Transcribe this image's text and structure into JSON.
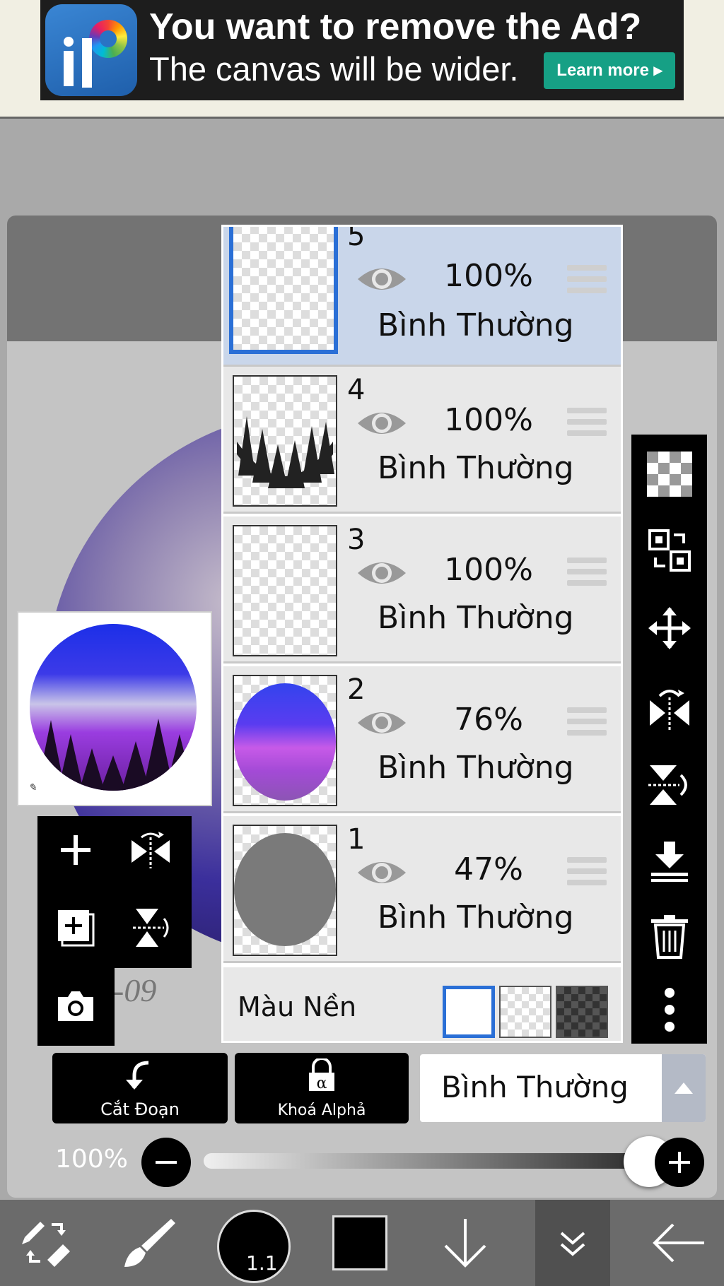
{
  "ad": {
    "title": "You want to remove the Ad?",
    "subtitle": "The canvas will be wider.",
    "learn_more": "Learn more ▸"
  },
  "canvas": {
    "sketch_text": "-09"
  },
  "layers": [
    {
      "num": "5",
      "opacity": "100%",
      "blend": "Bình Thường",
      "selected": true
    },
    {
      "num": "4",
      "opacity": "100%",
      "blend": "Bình Thường",
      "selected": false
    },
    {
      "num": "3",
      "opacity": "100%",
      "blend": "Bình Thường",
      "selected": false
    },
    {
      "num": "2",
      "opacity": "76%",
      "blend": "Bình Thường",
      "selected": false
    },
    {
      "num": "1",
      "opacity": "47%",
      "blend": "Bình Thường",
      "selected": false
    }
  ],
  "background": {
    "label": "Màu Nền"
  },
  "controls": {
    "clipping_label": "Cắt Đoạn",
    "alpha_lock_label": "Khoá Alphả",
    "blend_mode": "Bình Thường",
    "opacity_label": "100%",
    "opacity_value": 1.0
  },
  "toolbar": {
    "brush_size": "1.1",
    "current_color": "#000000"
  },
  "colors": {
    "selected_layer": "#c9d6ea",
    "selection_border": "#2a6fd6",
    "ad_button": "#16a085"
  }
}
